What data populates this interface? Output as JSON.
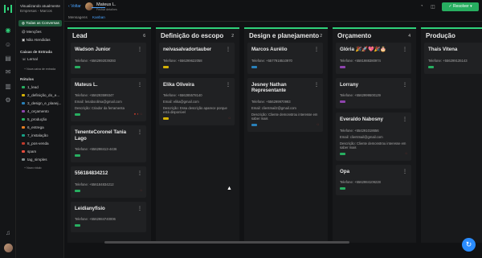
{
  "sidebar": {
    "workspace_title": "Visualizando atualmente",
    "workspace_name": "Empresas - Marcos",
    "items": {
      "all_conversations": "Todas as Conversas",
      "mentions": "Menções",
      "unattended": "Não Atendidas"
    },
    "inbox_section": "Caixas de Entrada",
    "inbox_item": "Lernal",
    "new_inbox": "Nova caixa de entrada",
    "labels_section": "Rótulos",
    "labels": [
      {
        "name": "1_lead",
        "color": "#27ae60"
      },
      {
        "name": "2_definição_do_e...",
        "color": "#d4b106"
      },
      {
        "name": "3_design_e_planej...",
        "color": "#2980b9"
      },
      {
        "name": "4_orçamento",
        "color": "#8e44ad"
      },
      {
        "name": "5_produção",
        "color": "#27ae60"
      },
      {
        "name": "6_entrega",
        "color": "#e67e22"
      },
      {
        "name": "7_instalação",
        "color": "#16a085"
      },
      {
        "name": "8_pos-venda",
        "color": "#c0392b"
      },
      {
        "name": "spam",
        "color": "#e74c3c"
      },
      {
        "name": "tag_simples",
        "color": "#7f8c8d"
      }
    ],
    "new_label": "Novo rótulo"
  },
  "topbar": {
    "back_label": "Voltar",
    "contact_name": "Mateus L.",
    "contact_status": "Fechar detalhes",
    "resolve_label": "Resolver"
  },
  "tabs": [
    "Mensagens",
    "Kanban"
  ],
  "columns": [
    {
      "title": "Lead",
      "count": "6",
      "cards": [
        {
          "name": "Wadson Junior",
          "lines": [
            "Telefone: +5562992039393"
          ],
          "tags": [
            "#27ae60"
          ]
        },
        {
          "name": "Mateus L.",
          "lines": [
            "Telefone: +556293599347",
            "Email: lenaboolima@gmail.com",
            "Descrição: Criador da ferramenta"
          ],
          "tags": [
            "#27ae60"
          ],
          "icon": "● ◐ ◌"
        },
        {
          "name": "TenenteCoronel Tania Lago",
          "lines": [
            "Telefone: +556298413-4436"
          ],
          "tags": [
            "#27ae60"
          ]
        },
        {
          "name": "556184834212",
          "lines": [
            "Telefone: +556184834212"
          ],
          "tags": [
            "#27ae60"
          ],
          "icon": "◌"
        },
        {
          "name": "Leidianyfisio",
          "lines": [
            "Telefone: +5562984740006"
          ],
          "tags": [
            "#27ae60"
          ]
        }
      ]
    },
    {
      "title": "Definição do escopo",
      "count": "2",
      "cards": [
        {
          "name": "neivasalvadortauber",
          "lines": [
            "Telefone: +556299622058"
          ],
          "tags": [
            "#d4b106"
          ]
        },
        {
          "name": "Elika Oliveira",
          "lines": [
            "Telefone: +556285578140",
            "Email: elika@gmail.com",
            "Descrição: Essa descrição aparece porque está disponível"
          ],
          "tags": [
            "#d4b106"
          ],
          "icon": "◌"
        }
      ]
    },
    {
      "title": "Design e planejamento",
      "count": "2",
      "cards": [
        {
          "name": "Marcos Aurélio",
          "lines": [
            "Telefone: +5577918510970"
          ],
          "tags": [
            "#2980b9"
          ]
        },
        {
          "name": "Jesney Nathan Representante",
          "lines": [
            "Telefone: +556299970993",
            "Email: clientmail2@gmail.com",
            "Descrição: Cliente demonstrou interesse em saber mais"
          ],
          "tags": [
            "#2980b9"
          ],
          "icon": "◌"
        }
      ]
    },
    {
      "title": "Orçamento",
      "count": "4",
      "cards": [
        {
          "name": "Glória 🎉🚀💖🎉🎂",
          "lines": [
            "Telefone: +5581988380974"
          ],
          "tags": [
            "#8e44ad"
          ]
        },
        {
          "name": "Lorrany",
          "lines": [
            "Telefone: +5562999500129"
          ],
          "tags": [
            "#8e44ad"
          ]
        },
        {
          "name": "Everaldo Nabosny",
          "lines": [
            "Telefone: +554291018656",
            "Email: clientmail@gmail.com",
            "Descrição: Cliente demonstrou interesse em saber mais"
          ],
          "tags": [
            "#27ae60"
          ],
          "icon": "◌"
        },
        {
          "name": "Opa",
          "lines": [
            "Telefone: +5562984109228"
          ],
          "tags": [
            "#27ae60"
          ]
        }
      ]
    },
    {
      "title": "Produção",
      "count": "",
      "cards": [
        {
          "name": "Thais Vitena",
          "lines": [
            "Telefone: +556299135143"
          ],
          "tags": [
            "#27ae60"
          ]
        }
      ]
    }
  ]
}
